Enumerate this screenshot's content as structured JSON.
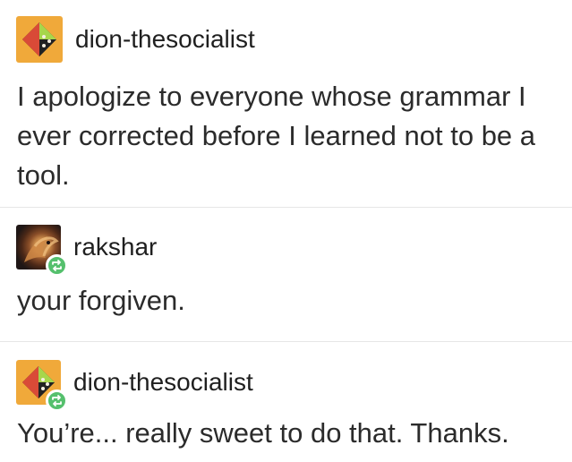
{
  "thread": {
    "posts": [
      {
        "username": "dion-thesocialist",
        "avatar_icon": "orange-diamond-avatar",
        "text": "I apologize to everyone whose grammar I ever corrected before I learned not to be a tool."
      },
      {
        "username": "rakshar",
        "avatar_icon": "dragon-photo-avatar",
        "reblog_icon": "reblog-icon",
        "text": "your forgiven."
      },
      {
        "username": "dion-thesocialist",
        "avatar_icon": "orange-diamond-avatar",
        "reblog_icon": "reblog-icon",
        "text": "You’re... really sweet to do that. Thanks."
      }
    ]
  },
  "colors": {
    "background": "#ffffff",
    "text": "#2b2b2b",
    "divider": "#e6e6e6",
    "avatar_orange": "#f0a93a",
    "reblog_green": "#55c06d"
  }
}
